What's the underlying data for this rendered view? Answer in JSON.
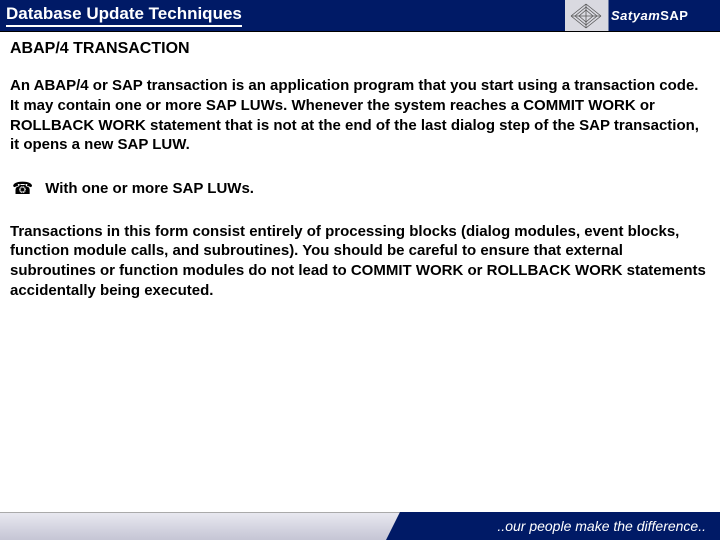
{
  "header": {
    "title": "Database Update Techniques",
    "brand": "Satyam",
    "brand_suffix": "SAP"
  },
  "content": {
    "subtitle": "ABAP/4 TRANSACTION",
    "para1": "An ABAP/4 or  SAP transaction is an application program that you start using a transaction code. It may contain one or more SAP LUWs. Whenever the system reaches a COMMIT WORK or ROLLBACK WORK statement that is not at the end of the last dialog step of the SAP transaction, it opens a new SAP LUW.",
    "bullet1": "With one or more SAP LUWs.",
    "para2": "Transactions in this form consist entirely of processing blocks (dialog modules, event blocks, function module calls, and subroutines). You should be careful to ensure that external subroutines or function modules do not lead to COMMIT WORK or ROLLBACK WORK statements accidentally being executed."
  },
  "footer": {
    "tagline": "..our people make the difference.."
  }
}
